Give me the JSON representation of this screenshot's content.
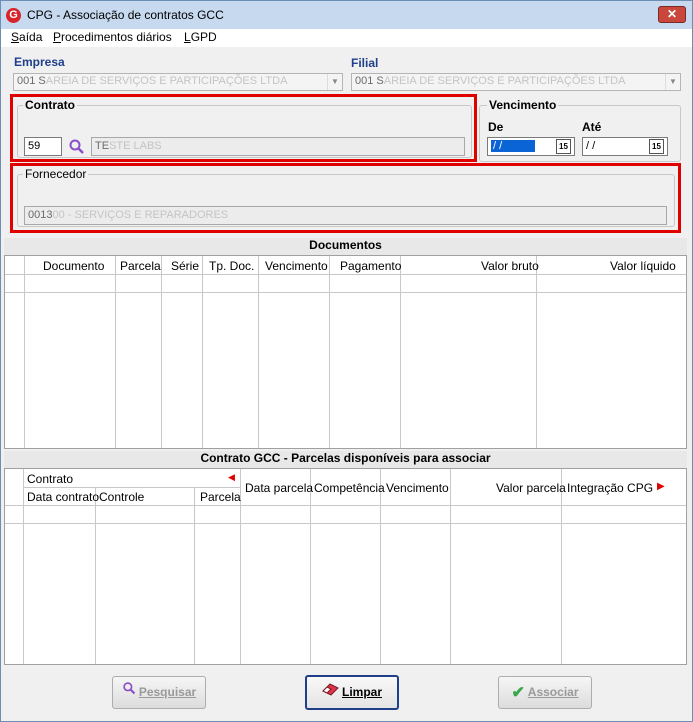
{
  "window": {
    "title": "CPG - Associação de contratos GCC",
    "close_label": "✕"
  },
  "menu": [
    "Saída",
    "Procedimentos diários",
    "LGPD"
  ],
  "empresa": {
    "label": "Empresa",
    "value": "001 S"
  },
  "filial": {
    "label": "Filial",
    "value": "001 S"
  },
  "contrato": {
    "label": "Contrato",
    "code": "59",
    "name": "TE"
  },
  "vencimento": {
    "label": "Vencimento",
    "de_label": "De",
    "ate_label": "Até",
    "de_value": "/ /",
    "ate_value": "/ /",
    "cal_icon": "15"
  },
  "fornecedor": {
    "label": "Fornecedor",
    "value": "0013"
  },
  "documentos": {
    "title": "Documentos",
    "columns": [
      "Documento",
      "Parcela",
      "Série",
      "Tp. Doc.",
      "Vencimento",
      "Pagamento",
      "Valor bruto",
      "Valor líquido"
    ]
  },
  "parcelas": {
    "title": "Contrato GCC - Parcelas disponíveis para associar",
    "group_label": "Contrato",
    "sub_columns": [
      "Data contrato",
      "Controle",
      "Parcela"
    ],
    "columns": [
      "Data parcela",
      "Competência",
      "Vencimento",
      "Valor parcela",
      "Integração CPG"
    ]
  },
  "buttons": {
    "pesquisar": "Pesquisar",
    "limpar": "Limpar",
    "associar": "Associar"
  },
  "colors": {
    "accent": "#1f3f8a",
    "highlight": "#e00000",
    "selection": "#0a64d6"
  }
}
